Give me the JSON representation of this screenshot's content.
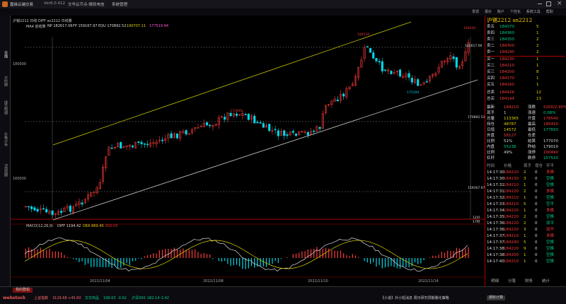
{
  "titlebar": {
    "app_name": "嘉缘云端交易",
    "version": "Ver8.0.412",
    "menu": [
      "文华云节点-微软电信",
      "系统管理"
    ]
  },
  "toolbar": {
    "items": [
      "发现",
      "报价",
      "账户",
      "个性化",
      "系统工具",
      "帮助"
    ]
  },
  "chart_header": {
    "symbol_line": "沪锡2212 日线 DIFF sn2212 日线量",
    "ma_line": {
      "label": "MA4 前结算",
      "np": "NP 182617.06",
      "fp": "FP 159167.97",
      "equ": "EQU 170892.52",
      "v1": "190707.11",
      "v2": "177519.94"
    }
  },
  "chart_data": {
    "type": "candlestick",
    "price_labels": [
      "184530",
      "172940",
      "175300",
      "184630"
    ],
    "level_labels": [
      "182617.06",
      "170892.52",
      "159167.97"
    ],
    "y_ticks": [
      "180000",
      "160000"
    ],
    "dates": [
      "2022/11/04",
      "2022/11/08",
      "2022/11/10",
      "2022/11/14"
    ],
    "macd_label": "MACD(12,26,9)",
    "diff": "DIFF 1194.42",
    "dea": "DEA 869.40",
    "macd": "650.05",
    "footer_tag": "12/0 17时"
  },
  "left_tabs": [
    "日线",
    "分时图",
    "成交明细",
    "价格分布",
    "K线周期"
  ],
  "quote": {
    "title": "沪锡2212  sn2212",
    "asks": [
      {
        "label": "卖五",
        "price": "184370",
        "vol": "5"
      },
      {
        "label": "卖四",
        "price": "184360",
        "vol": "1"
      },
      {
        "label": "卖三",
        "price": "184350",
        "vol": "2"
      },
      {
        "label": "卖二",
        "price": "184300",
        "vol": "2"
      },
      {
        "label": "卖一",
        "price": "184290",
        "vol": "2"
      }
    ],
    "bids": [
      {
        "label": "买一",
        "price": "184230",
        "vol": "1"
      },
      {
        "label": "买二",
        "price": "184210",
        "vol": "1"
      },
      {
        "label": "买三",
        "price": "184200",
        "vol": "8"
      },
      {
        "label": "买四",
        "price": "184170",
        "vol": "1"
      },
      {
        "label": "买五",
        "price": "184160",
        "vol": "1"
      }
    ],
    "totals": [
      {
        "label": "总卖",
        "price": "184426",
        "vol": "12"
      },
      {
        "label": "总买",
        "price": "184194",
        "vol": "13"
      }
    ],
    "stats": [
      [
        "最新",
        "184210",
        "涨跌",
        "5200/2.90%"
      ],
      [
        "现手",
        "1",
        "涨速",
        "0.08%"
      ],
      [
        "总量",
        "113365",
        "开盘",
        "178540"
      ],
      [
        "持仓",
        "48787",
        "最高",
        "185450"
      ],
      [
        "日增",
        "14572",
        "最低",
        "177650"
      ],
      [
        "外盘",
        "58127",
        "仓差",
        ""
      ],
      [
        "比例",
        "51%",
        "结算",
        "177070"
      ],
      [
        "内盘",
        "55238",
        "昨结",
        "179010"
      ],
      [
        "比例",
        "49%",
        "涨停",
        "200490"
      ],
      [
        "杠杆",
        "",
        "跌停",
        "157520"
      ]
    ],
    "ticks_header": [
      "时间",
      "价格",
      "现手",
      "增仓",
      "开平"
    ],
    "ticks": [
      [
        "14:17:30",
        "184220",
        "2",
        "0",
        "多换"
      ],
      [
        "14:17:30",
        "184230",
        "3",
        "0",
        "空换"
      ],
      [
        "14:17:31",
        "184210",
        "1",
        "0",
        "空换"
      ],
      [
        "14:17:31",
        "184220",
        "2",
        "0",
        "多换"
      ],
      [
        "14:17:32",
        "184210",
        "1",
        "0",
        "空换"
      ],
      [
        "14:17:33",
        "184210",
        "5",
        "0",
        "空平"
      ],
      [
        "14:17:34",
        "184220",
        "1",
        "0",
        "多换"
      ],
      [
        "14:17:35",
        "184220",
        "2",
        "0",
        "空换"
      ],
      [
        "14:17:36",
        "184220",
        "2",
        "0",
        "双平"
      ],
      [
        "14:17:36",
        "184220",
        "3",
        "0",
        "双开"
      ],
      [
        "14:17:37",
        "184210",
        "1",
        "0",
        "多换"
      ],
      [
        "14:17:37",
        "184240",
        "5",
        "0",
        "空换"
      ],
      [
        "14:17:38",
        "184220",
        "9",
        "0",
        "空换"
      ],
      [
        "14:17:38",
        "184200",
        "1",
        "0",
        "空换"
      ],
      [
        "14:17:40",
        "184210",
        "1",
        "0",
        "空换"
      ]
    ],
    "bottom_tabs": [
      "明细",
      "分笔",
      "财务",
      "统计"
    ]
  },
  "bottombar": {
    "top_tab": "我的群组",
    "logo": "webstock",
    "marquee": "【小道】外小短消息 周日研究预期量化策略",
    "indices": [
      {
        "name": "上证指数",
        "value": "3129.68",
        "change": "+45.60"
      },
      {
        "name": "文华商品",
        "value": "198.63",
        "change": "-0.62"
      },
      {
        "name": "沪深300",
        "value": "282.14",
        "change": "-3.42"
      }
    ],
    "right_tab": "期权计算"
  }
}
